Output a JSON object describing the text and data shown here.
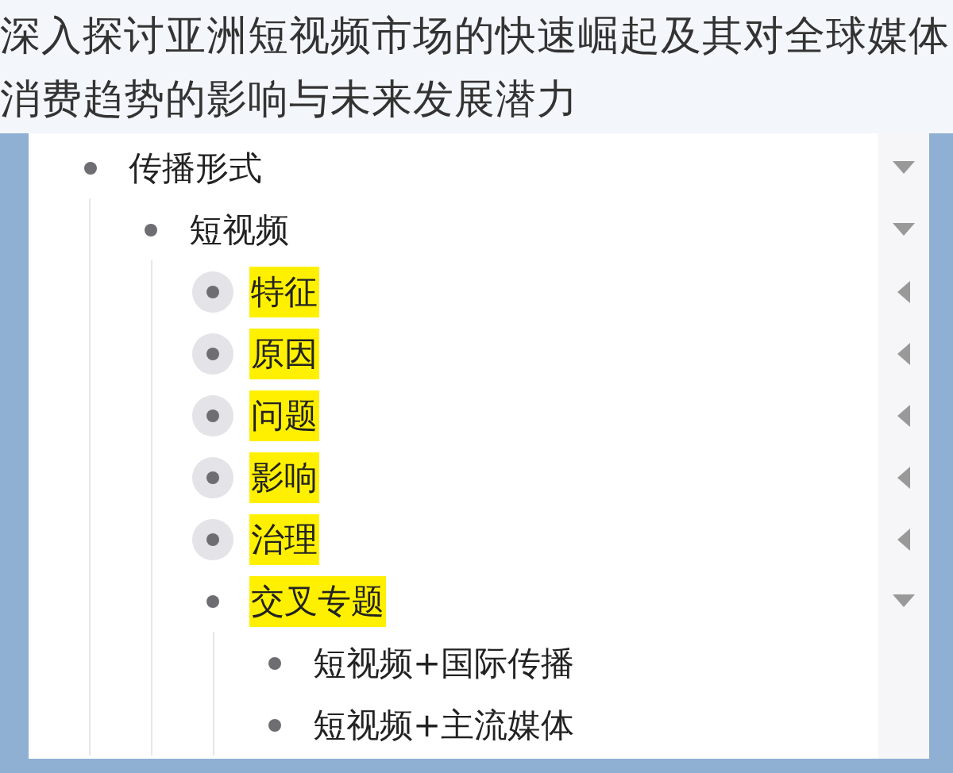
{
  "headline": "深入探讨亚洲短视频市场的快速崛起及其对全球媒体消费趋势的影响与未来发展潜力",
  "outline": [
    {
      "text": "传播形式",
      "highlighted": false,
      "expanded": true,
      "children": [
        {
          "text": "短视频",
          "highlighted": false,
          "expanded": true,
          "children": [
            {
              "text": "特征",
              "highlighted": true,
              "expanded": false,
              "has_children": true
            },
            {
              "text": "原因",
              "highlighted": true,
              "expanded": false,
              "has_children": true
            },
            {
              "text": "问题",
              "highlighted": true,
              "expanded": false,
              "has_children": true
            },
            {
              "text": "影响",
              "highlighted": true,
              "expanded": false,
              "has_children": true
            },
            {
              "text": "治理",
              "highlighted": true,
              "expanded": false,
              "has_children": true
            },
            {
              "text": "交叉专题",
              "highlighted": true,
              "expanded": true,
              "has_children": true,
              "children": [
                {
                  "text": "短视频+国际传播",
                  "highlighted": false,
                  "expanded": false,
                  "has_children": false
                },
                {
                  "text": "短视频+主流媒体",
                  "highlighted": false,
                  "expanded": false,
                  "has_children": false
                }
              ]
            }
          ]
        }
      ]
    }
  ]
}
